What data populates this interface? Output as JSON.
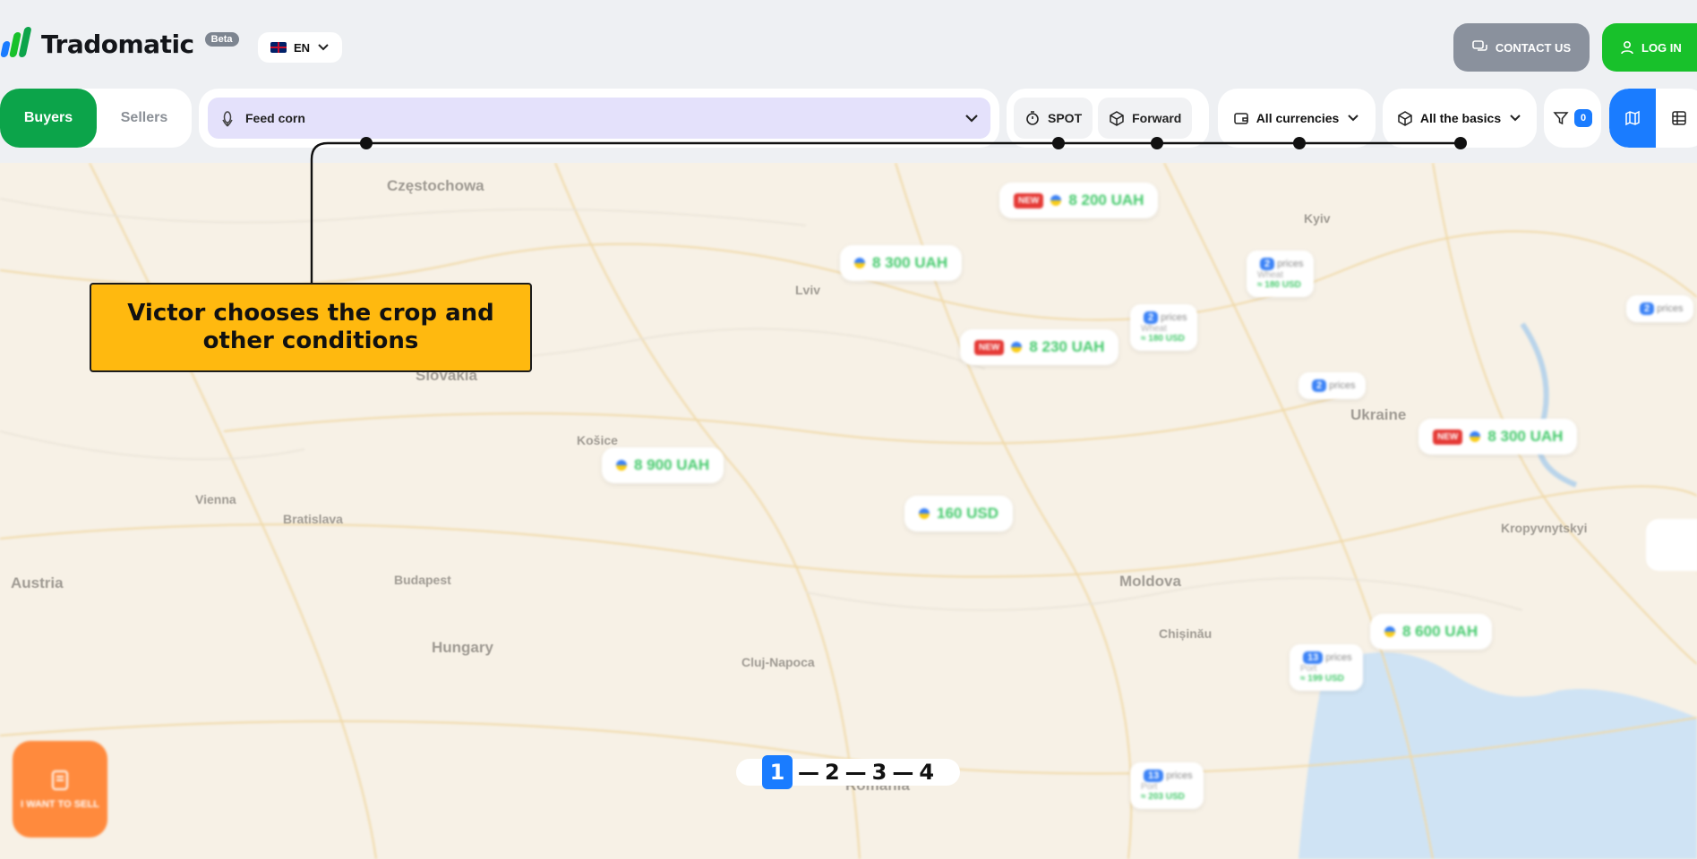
{
  "brand": {
    "name": "Tradomatic",
    "badge": "Beta",
    "mark_colors": [
      "#1a7cff",
      "#18c12b",
      "#0ca44a"
    ]
  },
  "language": {
    "code": "EN",
    "icon": "uk-flag-icon"
  },
  "header": {
    "contact_label": "CONTACT US",
    "login_label": "LOG IN"
  },
  "toggle": {
    "buyers": "Buyers",
    "sellers": "Sellers",
    "active": "Buyers"
  },
  "crop": {
    "selected": "Feed corn",
    "icon": "corn-icon"
  },
  "basis": {
    "spot": "SPOT",
    "forward": "Forward"
  },
  "currency": {
    "label": "All currencies"
  },
  "basics": {
    "label": "All the basics"
  },
  "filters": {
    "count": "0"
  },
  "view": {
    "active": "map"
  },
  "callout": {
    "text": "Victor chooses the crop and other conditions"
  },
  "steps": [
    "1",
    "2",
    "3",
    "4"
  ],
  "active_step": "1",
  "sell_button": {
    "label": "I WANT TO SELL"
  },
  "map": {
    "places": {
      "czestochowa": "Częstochowa",
      "slovakia": "Slovakia",
      "austria": "Austria",
      "hungary": "Hungary",
      "moldova": "Moldova",
      "ukraine": "Ukraine",
      "bratislava": "Bratislava",
      "budapest": "Budapest",
      "kosice": "Košice",
      "vienna": "Vienna",
      "cluj": "Cluj-Napoca",
      "romania": "Romania",
      "chisinau": "Chișinău",
      "kyiv": "Kyiv",
      "lviv": "Lviv",
      "kropyvnytskyi": "Kropyvnytskyi"
    },
    "prices": [
      {
        "text": "8 200 UAH",
        "new": true
      },
      {
        "text": "8 300 UAH",
        "new": false
      },
      {
        "text": "8 230 UAH",
        "new": true
      },
      {
        "text": "8 900 UAH",
        "new": false
      },
      {
        "text": "160 USD",
        "new": false
      },
      {
        "text": "8 300 UAH",
        "new": true
      },
      {
        "text": "8 600 UAH",
        "new": false
      }
    ],
    "clusters": [
      {
        "count": "2",
        "label": "prices",
        "sub": "Wheat",
        "usd": "≈ 180 USD"
      },
      {
        "count": "2",
        "label": "prices",
        "sub": "Wheat",
        "usd": "≈ 180 USD"
      },
      {
        "count": "2",
        "label": "prices",
        "sub": "",
        "usd": ""
      },
      {
        "count": "2",
        "label": "prices",
        "sub": "",
        "usd": ""
      },
      {
        "count": "13",
        "label": "prices",
        "sub": "Port",
        "usd": "≈ 199 USD"
      },
      {
        "count": "13",
        "label": "prices",
        "sub": "Port",
        "usd": "≈ 203 USD"
      }
    ],
    "new_badge": "NEW"
  }
}
